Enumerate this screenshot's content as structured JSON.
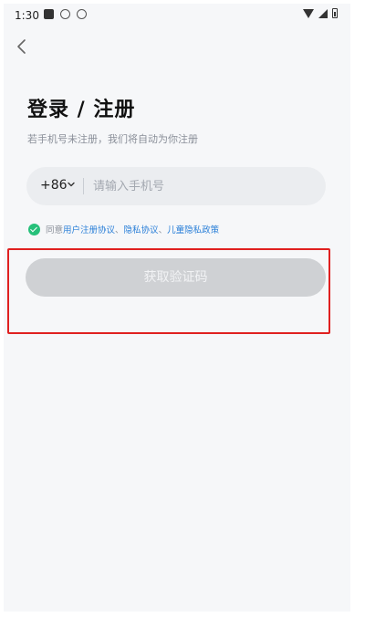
{
  "status_bar": {
    "time": "1:30"
  },
  "header": {
    "back_icon": "chevron-left-icon"
  },
  "login": {
    "title": "登录 / 注册",
    "subtitle": "若手机号未注册，我们将自动为你注册",
    "country_code": "+86",
    "phone_placeholder": "请输入手机号",
    "agree_prefix": "同意",
    "agreements": [
      "用户注册协议",
      "隐私协议",
      "儿童隐私政策"
    ],
    "agreement_sep": "、",
    "get_code_button": "获取验证码",
    "agreed": true
  },
  "colors": {
    "accent_link": "#2a7fd8",
    "check_green": "#26c07a",
    "button_disabled": "#cfd1d4",
    "highlight_red": "#e02020"
  }
}
